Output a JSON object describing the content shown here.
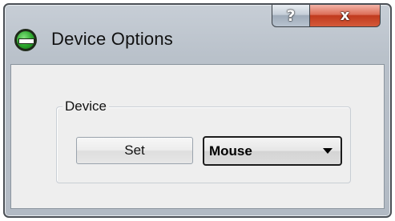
{
  "window": {
    "title": "Device Options",
    "icon": "green-circle-minus-icon",
    "help_label": "?",
    "close_label": "x"
  },
  "group": {
    "label": "Device"
  },
  "set_button": {
    "label": "Set"
  },
  "device_select": {
    "value": "Mouse",
    "icon": "dropdown-arrow-icon"
  },
  "colors": {
    "close_button": "#c03a1e",
    "title_bar": "#b9c1ca",
    "client_background": "#eeeeee",
    "app_icon": "#2aa52b"
  }
}
